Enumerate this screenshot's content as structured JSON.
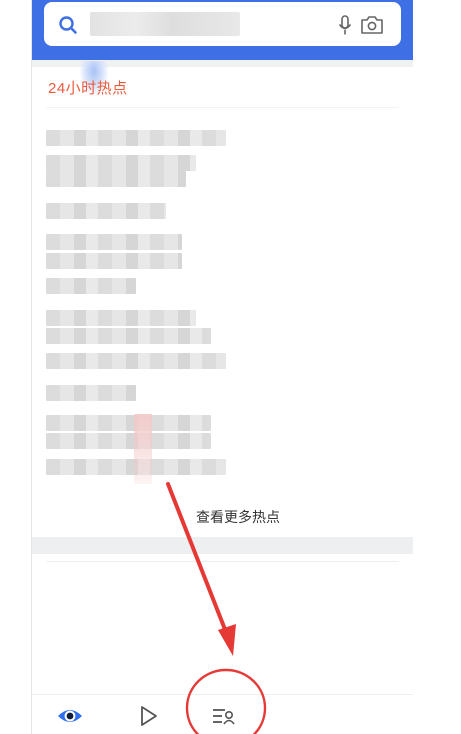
{
  "header": {
    "search": {
      "placeholder": "",
      "icons": [
        "search-icon",
        "mic-icon",
        "camera-icon"
      ]
    }
  },
  "hot": {
    "title": "24小时热点",
    "items": [
      "",
      "",
      "",
      "",
      "",
      "",
      "",
      "",
      "",
      "",
      "",
      "",
      "",
      ""
    ],
    "more_label": "查看更多热点"
  },
  "bottom_nav": {
    "tabs": [
      {
        "icon": "eye-icon",
        "active": true
      },
      {
        "icon": "play-icon",
        "active": false
      },
      {
        "icon": "list-person-icon",
        "active": false
      }
    ]
  },
  "colors": {
    "brand_blue": "#3f6fe5",
    "hot_red": "#ec5a3d",
    "annotation_red": "#e53935"
  }
}
